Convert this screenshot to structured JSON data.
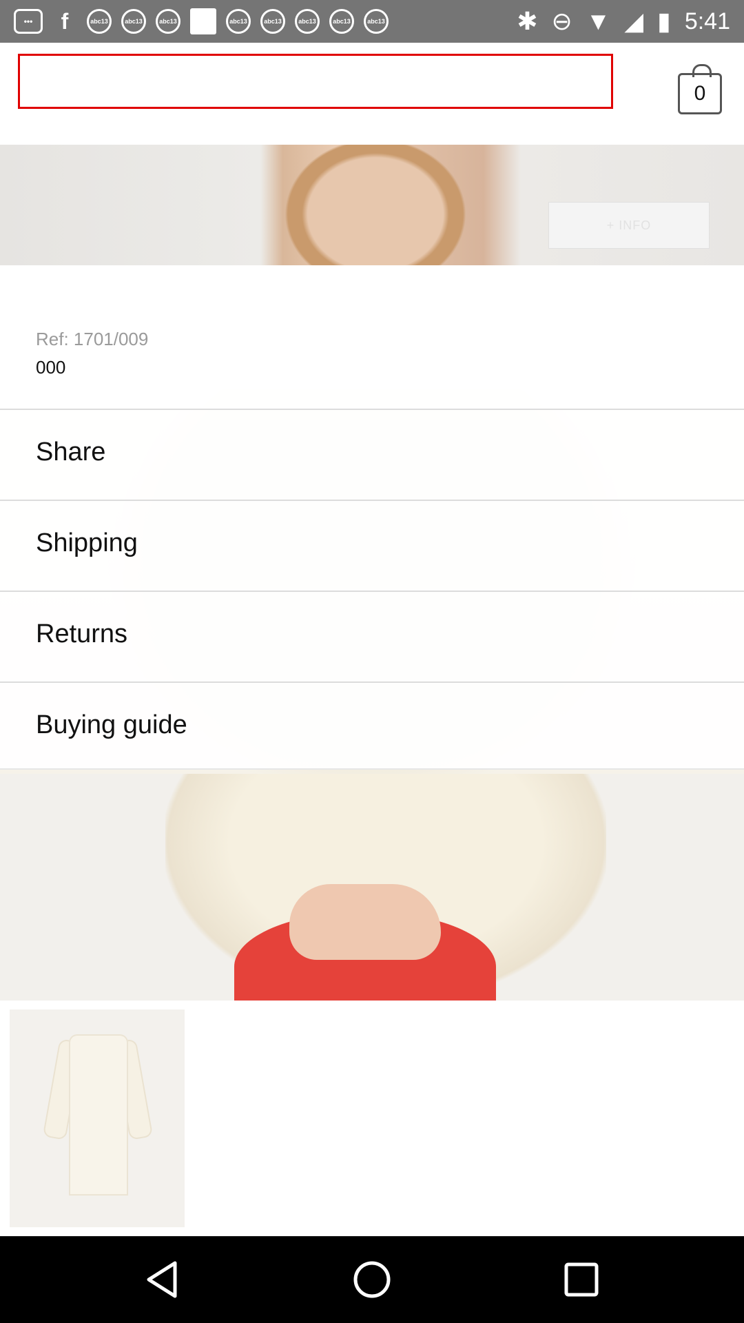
{
  "statusbar": {
    "notification_icons": [
      "messages-icon",
      "facebook-icon",
      "abc13-icon",
      "abc13-icon",
      "abc13-icon",
      "white-square-icon",
      "abc13-icon",
      "abc13-icon",
      "abc13-icon",
      "abc13-icon",
      "abc13-icon"
    ],
    "abc_label": "abc13",
    "time": "5:41"
  },
  "header": {
    "search_value": "",
    "cart_count": "0"
  },
  "hero": {
    "info_label": "+ INFO"
  },
  "product": {
    "ref": "Ref: 1701/009",
    "code": "000"
  },
  "menu": {
    "items": [
      {
        "label": "Share"
      },
      {
        "label": "Shipping"
      },
      {
        "label": "Returns"
      },
      {
        "label": "Buying guide"
      }
    ]
  },
  "colors": {
    "search_border": "#e00000",
    "statusbar": "#757575",
    "navbar": "#000000"
  }
}
